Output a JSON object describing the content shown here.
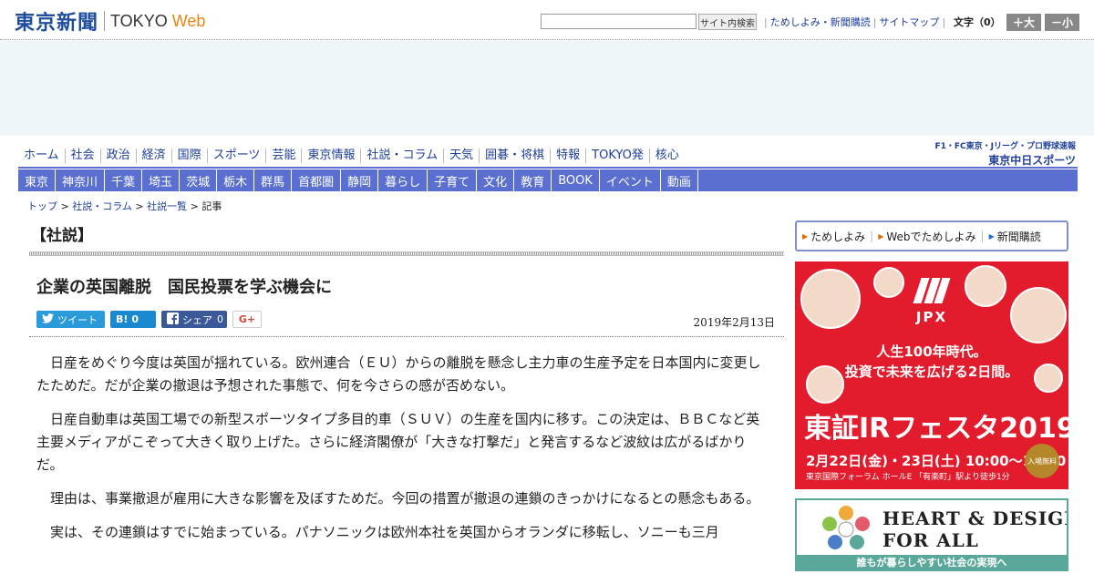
{
  "header": {
    "logo_jp": "東京新聞",
    "logo_en": "TOKYO",
    "logo_web": "Web",
    "search_placeholder": "",
    "search_button": "サイト内検索",
    "links": [
      "ためしよみ・新聞購読",
      "サイトマップ"
    ],
    "font_size_label": "文字（0）",
    "font_up": "＋大",
    "font_down": "－小"
  },
  "main_nav": [
    "ホーム",
    "社会",
    "政治",
    "経済",
    "国際",
    "スポーツ",
    "芸能",
    "東京情報",
    "社説・コラム",
    "天気",
    "囲碁・将棋",
    "特報",
    "TOKYO発",
    "核心"
  ],
  "sponsor": {
    "sub": "F1・FC東京・Jリーグ・プロ野球速報",
    "name": "東京中日スポーツ"
  },
  "region_nav": [
    "東京",
    "神奈川",
    "千葉",
    "埼玉",
    "茨城",
    "栃木",
    "群馬",
    "首都圏",
    "静岡",
    "暮らし",
    "子育て",
    "文化",
    "教育",
    "BOOK",
    "イベント",
    "動画"
  ],
  "breadcrumb": {
    "items": [
      "トップ",
      "社説・コラム",
      "社説一覧"
    ],
    "current": "記事",
    "separator": ">"
  },
  "section_title": "【社説】",
  "article": {
    "headline": "企業の英国離脱　国民投票を学ぶ機会に",
    "date": "2019年2月13日",
    "paragraphs": [
      "日産をめぐり今度は英国が揺れている。欧州連合（ＥＵ）からの離脱を懸念し主力車の生産予定を日本国内に変更したためだ。だが企業の撤退は予想された事態で、何を今さらの感が否めない。",
      "日産自動車は英国工場での新型スポーツタイプ多目的車（ＳＵＶ）の生産を国内に移す。この決定は、ＢＢＣなど英主要メディアがこぞって大きく取り上げた。さらに経済閣僚が「大きな打撃だ」と発言するなど波紋は広がるばかりだ。",
      "理由は、事業撤退が雇用に大きな影響を及ぼすためだ。今回の措置が撤退の連鎖のきっかけになるとの懸念もある。",
      "実は、その連鎖はすでに始まっている。パナソニックは欧州本社を英国からオランダに移転し、ソニーも三月"
    ]
  },
  "share": {
    "twitter": "ツイート",
    "hatena_icon": "B!",
    "hatena_count": "0",
    "facebook": "シェア",
    "facebook_count": "0",
    "gplus": "G+"
  },
  "sidebar": {
    "links": [
      "ためしよみ",
      "Webでためしよみ",
      "新聞購読"
    ],
    "banner1": {
      "org": "JPX",
      "tagline1": "人生100年時代。",
      "tagline2": "投資で未来を広げる2日間。",
      "title": "東証IRフェスタ2019",
      "date": "2月22日(金)・23日(土) 10:00～18:00",
      "venue": "東京国際フォーラム ホールE 「有楽町」駅より徒歩1分",
      "badge": "入場無料"
    },
    "banner2": {
      "line1": "HEART & DESIGN",
      "line2": "FOR ALL",
      "caption": "誰もが暮らしやすい社会の実現へ"
    }
  },
  "colors": {
    "brand_blue": "#1f4e9e",
    "nav_blue": "#5a6fd0",
    "accent_orange": "#e8850f",
    "ad_bg": "#eef6fa",
    "banner_red": "#e21c2c",
    "banner_teal": "#5aa89a"
  }
}
